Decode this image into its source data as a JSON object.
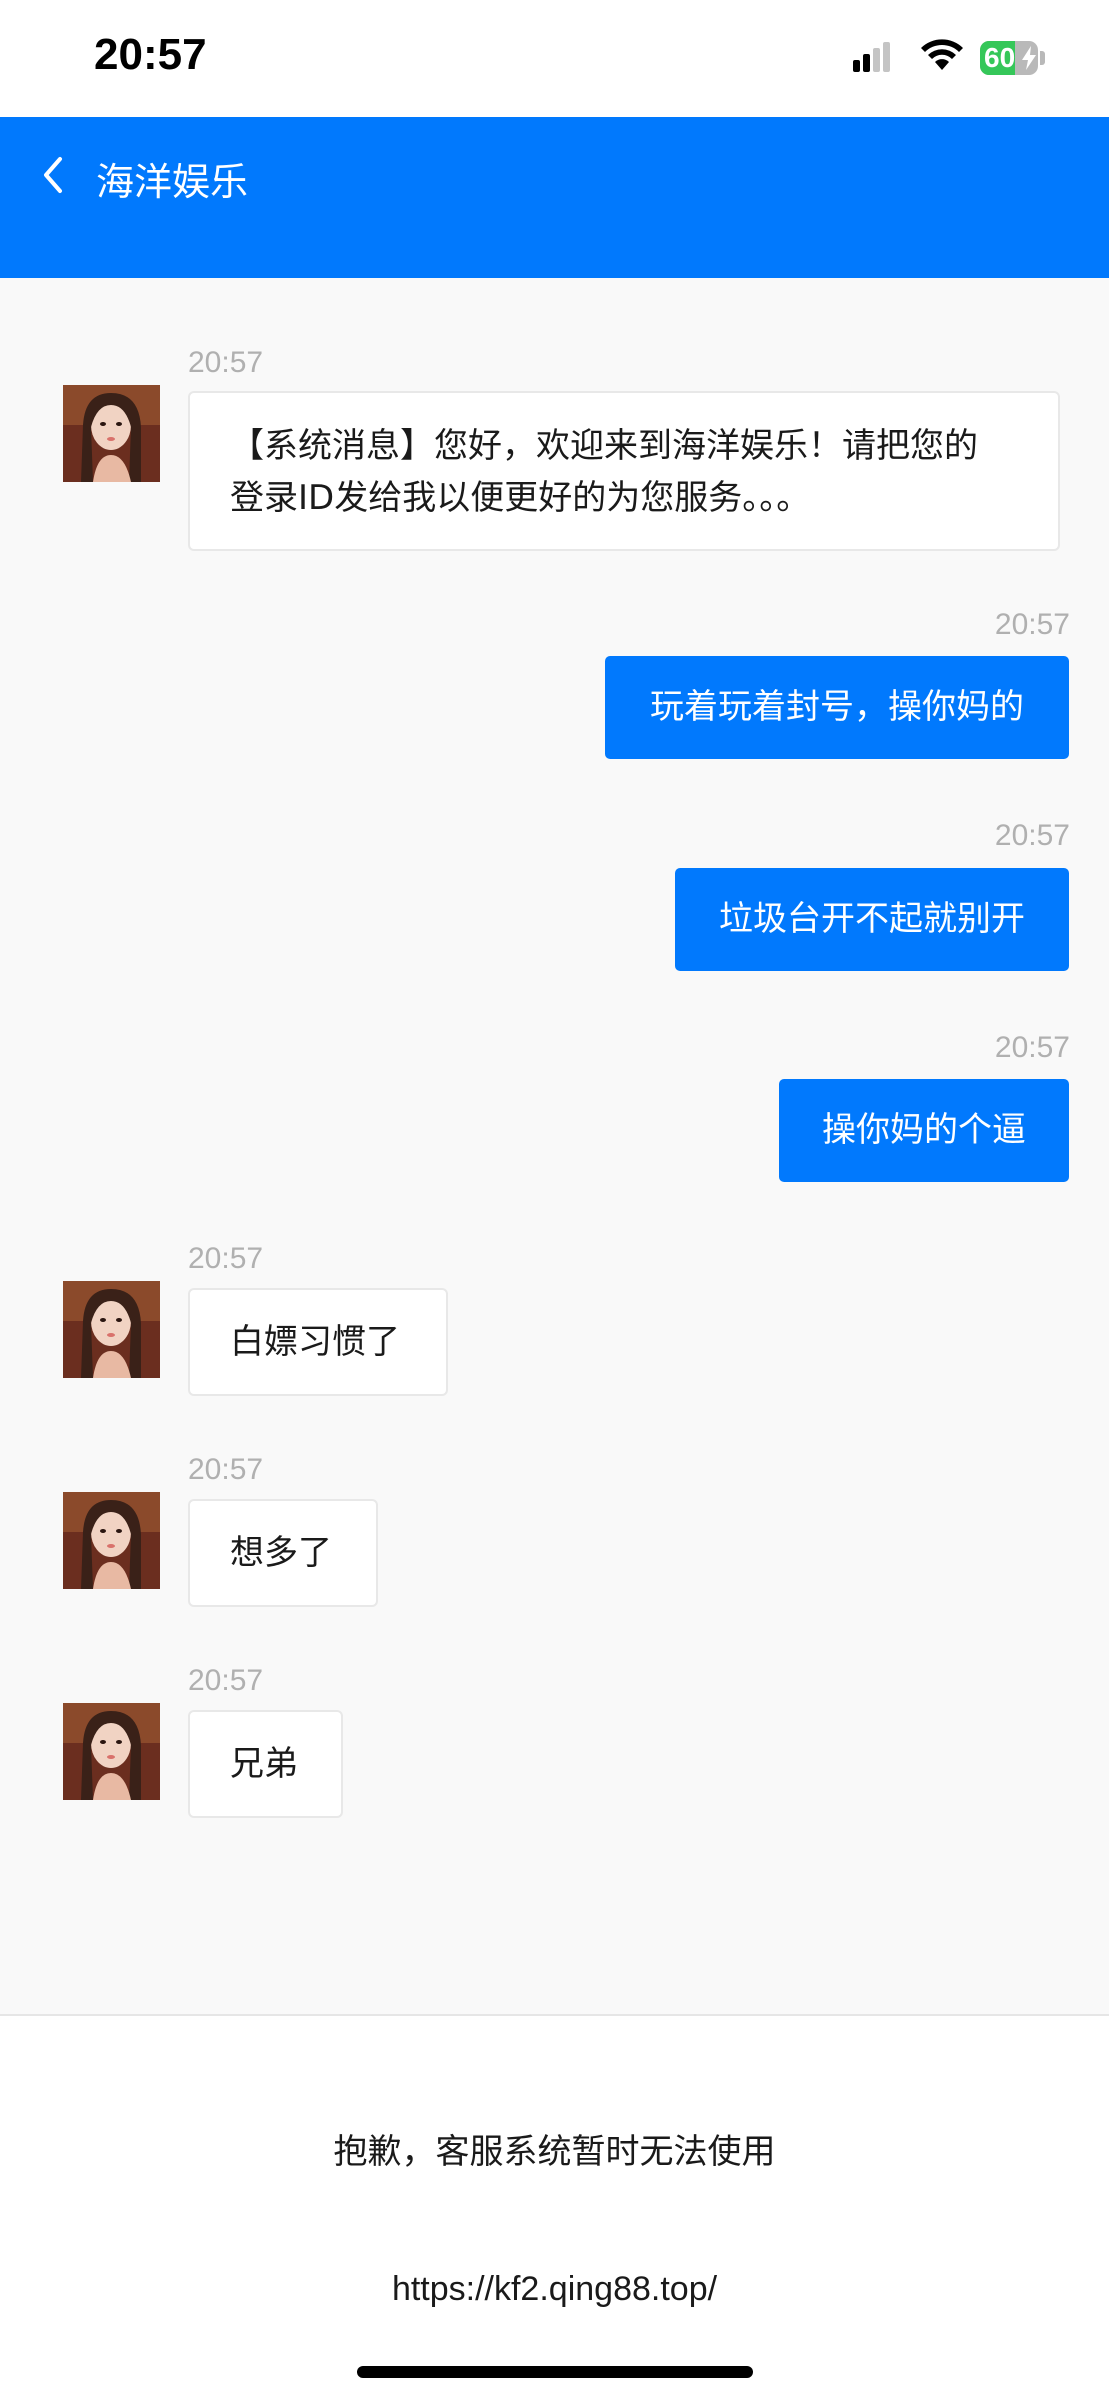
{
  "status_bar": {
    "time": "20:57",
    "battery_level": "60",
    "battery_fraction": 0.6,
    "charging": true,
    "icons": [
      "signal-icon",
      "wifi-icon",
      "battery-icon",
      "charging-bolt-icon"
    ]
  },
  "header": {
    "back_icon": "chevron-left-icon",
    "title": "海洋娱乐",
    "background_color": "#0179fd"
  },
  "messages": [
    {
      "side": "in",
      "time": "20:57",
      "lines": [
        "【系统消息】您好，欢迎来到海洋娱乐！请把您的",
        "登录ID发给我以便更好的为您服务。。。"
      ]
    },
    {
      "side": "out",
      "time": "20:57",
      "text": "玩着玩着封号，操你妈的"
    },
    {
      "side": "out",
      "time": "20:57",
      "text": "垃圾台开不起就别开"
    },
    {
      "side": "out",
      "time": "20:57",
      "text": "操你妈的个逼"
    },
    {
      "side": "in",
      "time": "20:57",
      "text": "白嫖习惯了"
    },
    {
      "side": "in",
      "time": "20:57",
      "text": "想多了"
    },
    {
      "side": "in",
      "time": "20:57",
      "text": "兄弟"
    }
  ],
  "footer": {
    "notice": "抱歉，客服系统暂时无法使用",
    "url": "https://kf2.qing88.top/"
  },
  "colors": {
    "accent": "#0179fd",
    "incoming_bubble": "#ffffff",
    "chat_background": "#f9f9f9"
  }
}
